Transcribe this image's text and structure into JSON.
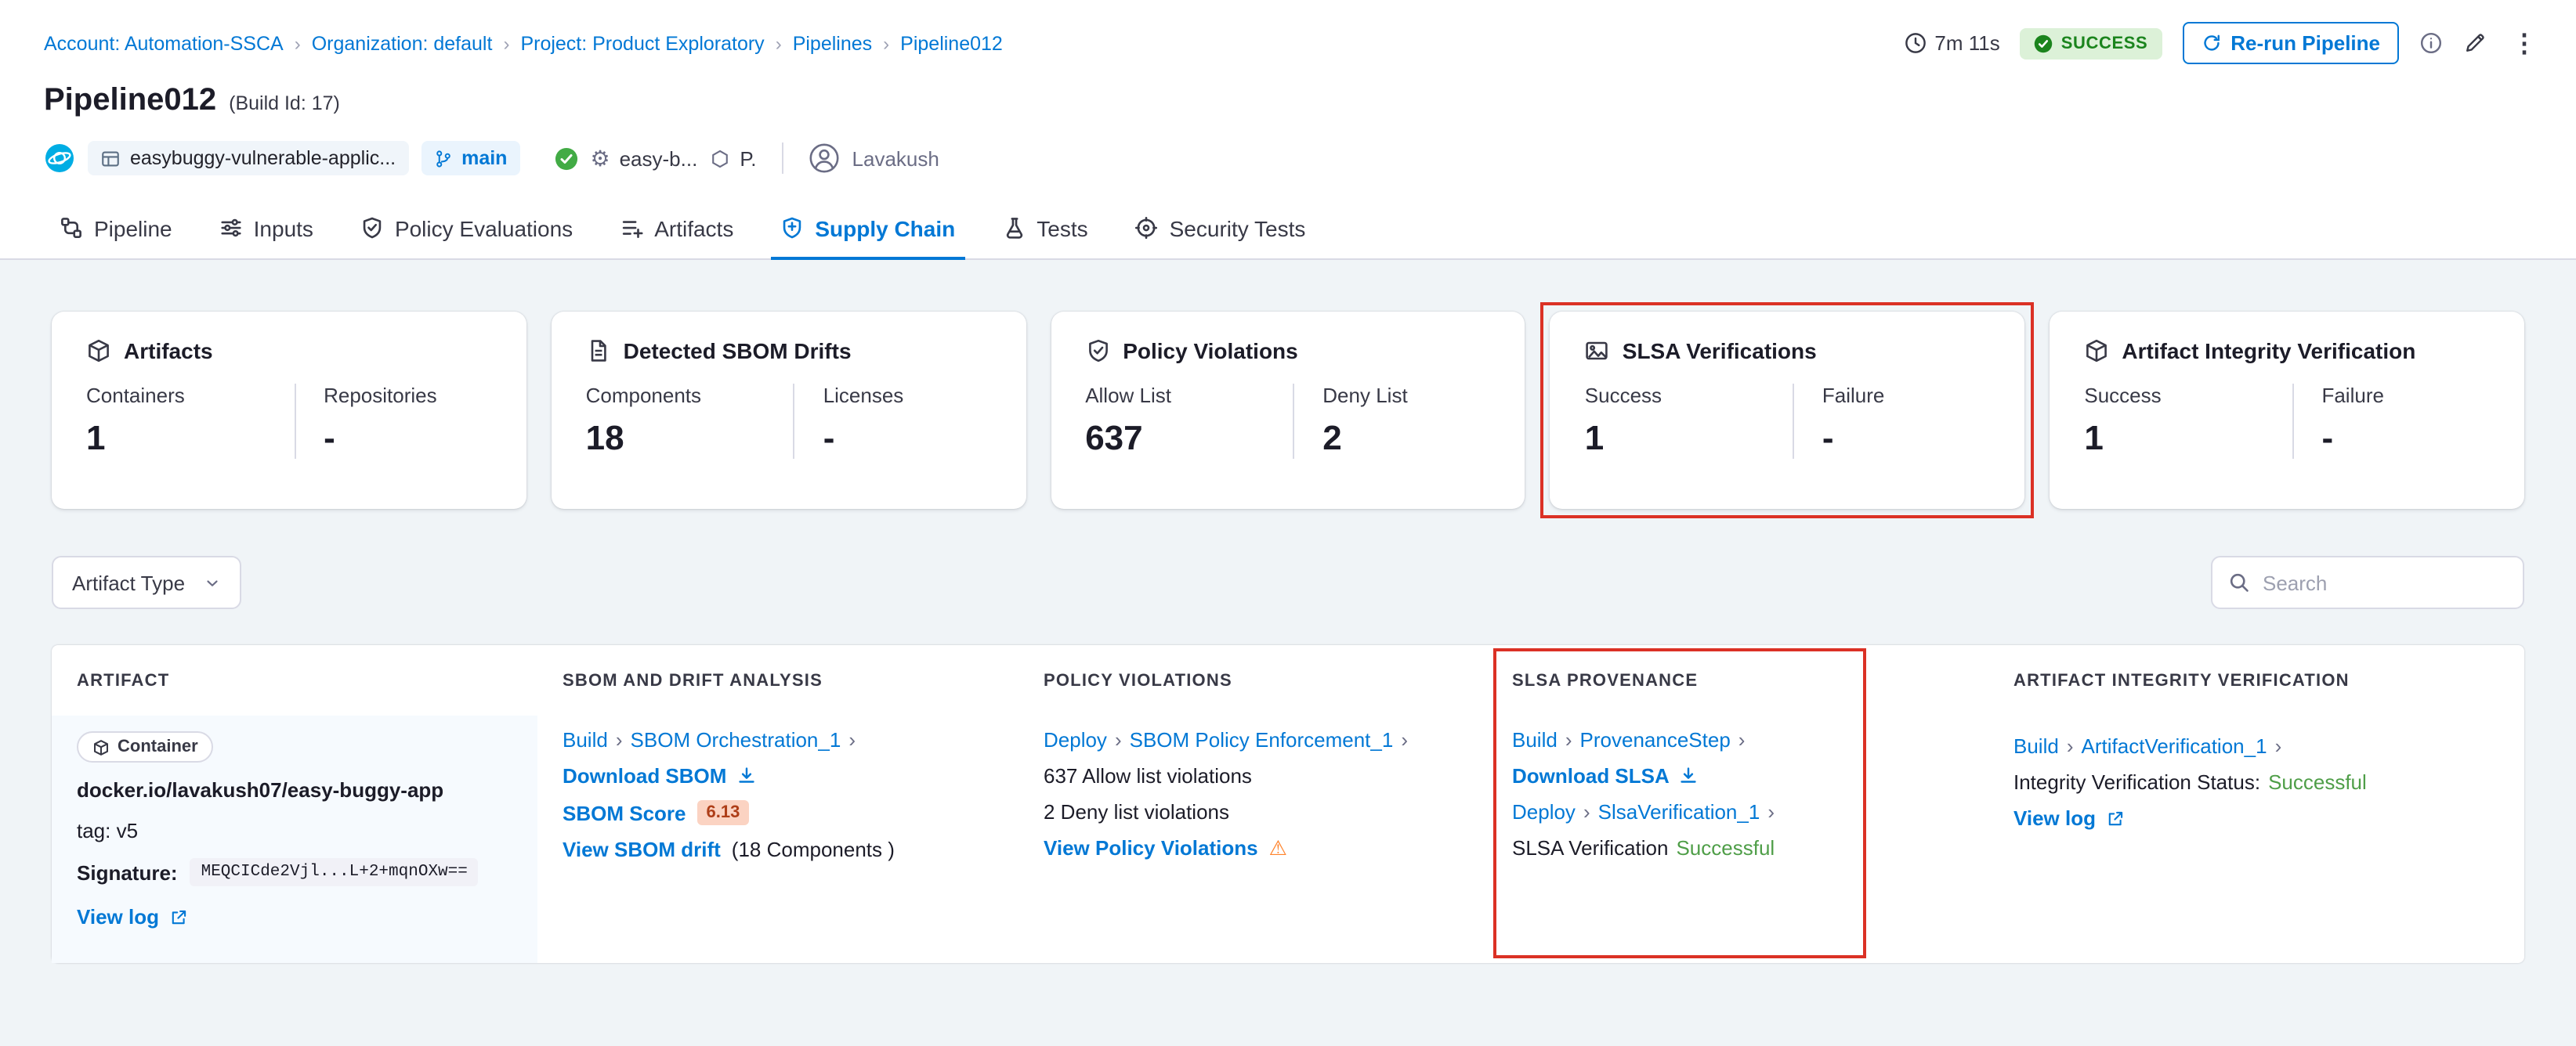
{
  "icons": {
    "chevron": "›",
    "gear": "⚙",
    "kebab": "⋮",
    "warning": "⚠"
  },
  "breadcrumb": {
    "separator": "›",
    "items": [
      {
        "label": "Account: Automation-SSCA"
      },
      {
        "label": "Organization: default"
      },
      {
        "label": "Project: Product Exploratory"
      },
      {
        "label": "Pipelines"
      },
      {
        "label": "Pipeline012"
      }
    ]
  },
  "topbar": {
    "duration": "7m 11s",
    "status_badge": "SUCCESS",
    "rerun_button": "Re-run Pipeline"
  },
  "header": {
    "title": "Pipeline012",
    "build_id": "(Build Id: 17)",
    "repo_chip": "easybuggy-vulnerable-applic...",
    "branch_chip": "main",
    "service_name": "easy-b...",
    "environment_name": "P.",
    "user_name": "Lavakush"
  },
  "tabs": [
    {
      "label": "Pipeline",
      "active": false
    },
    {
      "label": "Inputs",
      "active": false
    },
    {
      "label": "Policy Evaluations",
      "active": false
    },
    {
      "label": "Artifacts",
      "active": false
    },
    {
      "label": "Supply Chain",
      "active": true
    },
    {
      "label": "Tests",
      "active": false
    },
    {
      "label": "Security Tests",
      "active": false
    }
  ],
  "summary_cards": [
    {
      "title": "Artifacts",
      "metrics": [
        {
          "label": "Containers",
          "value": "1"
        },
        {
          "label": "Repositories",
          "value": "-"
        }
      ]
    },
    {
      "title": "Detected SBOM Drifts",
      "metrics": [
        {
          "label": "Components",
          "value": "18"
        },
        {
          "label": "Licenses",
          "value": "-"
        }
      ]
    },
    {
      "title": "Policy Violations",
      "metrics": [
        {
          "label": "Allow List",
          "value": "637"
        },
        {
          "label": "Deny List",
          "value": "2"
        }
      ]
    },
    {
      "title": "SLSA Verifications",
      "highlighted": true,
      "metrics": [
        {
          "label": "Success",
          "value": "1"
        },
        {
          "label": "Failure",
          "value": "-"
        }
      ]
    },
    {
      "title": "Artifact Integrity Verification",
      "metrics": [
        {
          "label": "Success",
          "value": "1"
        },
        {
          "label": "Failure",
          "value": "-"
        }
      ]
    }
  ],
  "filters": {
    "artifact_type": "Artifact Type",
    "search_placeholder": "Search"
  },
  "table": {
    "headers": [
      "ARTIFACT",
      "SBOM AND DRIFT ANALYSIS",
      "POLICY VIOLATIONS",
      "SLSA PROVENANCE",
      "ARTIFACT INTEGRITY VERIFICATION"
    ],
    "row": {
      "artifact": {
        "type": "Container",
        "image": "docker.io/lavakush07/easy-buggy-app",
        "tag": "tag: v5",
        "signature_label": "Signature:",
        "signature_value": "MEQCICde2Vjl...L+2+mqnOXw==",
        "view_log": "View log"
      },
      "sbom": {
        "stage": "Build",
        "step": "SBOM Orchestration_1",
        "download": "Download SBOM",
        "score_link": "SBOM Score",
        "score_value": "6.13",
        "drift_link": "View SBOM drift",
        "drift_suffix": "(18 Components )"
      },
      "policy": {
        "stage": "Deploy",
        "step": "SBOM Policy Enforcement_1",
        "allow_text": "637 Allow list violations",
        "deny_text": "2 Deny list violations",
        "view_link": "View Policy Violations"
      },
      "slsa": {
        "stage1": "Build",
        "step1": "ProvenanceStep",
        "download": "Download SLSA",
        "stage2": "Deploy",
        "step2": "SlsaVerification_1",
        "status_label": "SLSA Verification",
        "status_value": "Successful"
      },
      "integrity": {
        "stage": "Build",
        "step": "ArtifactVerification_1",
        "status_label": "Integrity Verification Status:",
        "status_value": "Successful",
        "view_log": "View log"
      }
    }
  },
  "annotations": {
    "highlight_color": "#DB3125",
    "highlighted_card": "SLSA Verifications",
    "highlighted_column": "SLSA PROVENANCE"
  },
  "colors": {
    "primary_blue": "#0278D5",
    "success_green": "#1B841D",
    "status_green": "#4F9E48",
    "warning_orange": "#FF832B",
    "page_background": "#F0F4F7"
  }
}
